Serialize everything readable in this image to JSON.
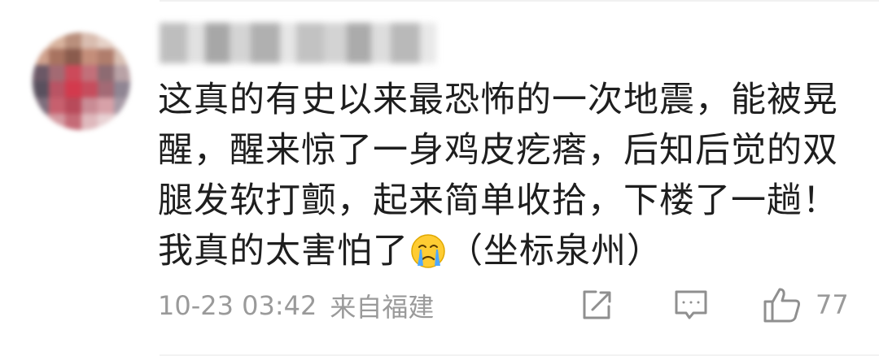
{
  "comment": {
    "text_before_emoji": "这真的有史以来最恐怖的一次地震，能被晃醒，醒来惊了一身鸡皮疙瘩，后知后觉的双腿发软打颤，起来简单收拾，下楼了一趟！我真的太害怕了",
    "emoji": "crying-face-emoji",
    "text_after_emoji": "（坐标泉州）"
  },
  "meta": {
    "timestamp": "10-23 03:42",
    "location": "来自福建"
  },
  "actions": {
    "share_icon": "share-icon",
    "comment_icon": "comment-icon",
    "like_icon": "thumbs-up-icon",
    "like_count": "77"
  },
  "colors": {
    "text": "#1e1e1e",
    "meta_text": "#9a9a9a",
    "icon": "#8f8f8f",
    "background": "#ffffff"
  }
}
